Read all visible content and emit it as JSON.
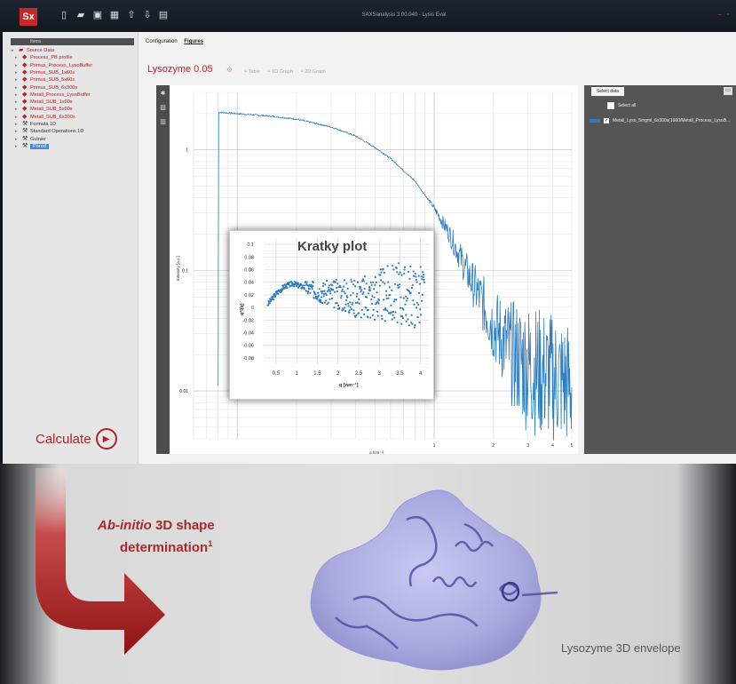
{
  "app": {
    "logo": "Sx",
    "title": "SAXSanalysis 3.00.040 - Lysis Eval",
    "toolbar_icons": [
      "new-file-icon",
      "open-folder-icon",
      "save-icon",
      "save-as-icon",
      "export-icon",
      "import-icon",
      "report-icon"
    ]
  },
  "tree": {
    "header": "Items",
    "items": [
      {
        "label": "Source Data",
        "color": "red",
        "icon": "folder-icon",
        "level": 0
      },
      {
        "label": "Process_PB profile",
        "color": "red",
        "icon": "data-icon",
        "level": 1
      },
      {
        "label": "Primus_Process_LysoBuffer",
        "color": "red",
        "icon": "data-icon",
        "level": 1
      },
      {
        "label": "Primus_SUB_1x60s",
        "color": "red",
        "icon": "data-icon",
        "level": 1
      },
      {
        "label": "Primus_SUB_5x60s",
        "color": "red",
        "icon": "data-icon",
        "level": 1
      },
      {
        "label": "Primus_SUB_6x300s",
        "color": "red",
        "icon": "data-icon",
        "level": 1
      },
      {
        "label": "Metall_Process_LysoBuffer",
        "color": "red",
        "icon": "data-icon",
        "level": 1
      },
      {
        "label": "Metall_SUB_1x60s",
        "color": "red",
        "icon": "data-icon",
        "level": 1
      },
      {
        "label": "Metall_SUB_5x60s",
        "color": "red",
        "icon": "data-icon",
        "level": 1
      },
      {
        "label": "Metall_SUB_6x300s",
        "color": "red",
        "icon": "data-icon",
        "level": 1
      },
      {
        "label": "Formula 1D",
        "color": "dark",
        "icon": "wrench-icon",
        "level": 1
      },
      {
        "label": "Standard Operations 1D",
        "color": "dark",
        "icon": "wrench-icon",
        "level": 1
      },
      {
        "label": "Guinier",
        "color": "dark",
        "icon": "wrench-icon",
        "level": 1
      },
      {
        "label": "Porod",
        "color": "dark",
        "icon": "wrench-icon",
        "level": 1,
        "selected": true
      }
    ]
  },
  "calculate_label": "Calculate",
  "tabs": {
    "configuration": "Configuration",
    "figures": "Figures"
  },
  "document_tab": "Lysozyme 0.05",
  "view_tabs": [
    "+ Table",
    "+ 1D Graph",
    "+ 2D Graph"
  ],
  "right_panel": {
    "select_data": "Select data",
    "select_all": "Select all",
    "series_label": "Metall_Lyso_5mgml_6x300s(1660/Metall_Process_LysoB..."
  },
  "colors": {
    "accent_red": "#b3212b",
    "series_blue": "#2f7fc0"
  },
  "chart_data": [
    {
      "type": "line",
      "scale": "log-log",
      "xlabel": "q [nm⁻¹]",
      "ylabel": "Intensity [a.u.]",
      "x_ticks": [
        "1",
        "2",
        "3",
        "4",
        "5"
      ],
      "y_ticks": [
        "1",
        "0.1",
        "0.01"
      ],
      "xlim": [
        0.06,
        5
      ],
      "ylim": [
        0.004,
        3
      ],
      "series": [
        {
          "color": "#2f7fc0",
          "x": [
            0.08,
            0.1,
            0.15,
            0.2,
            0.3,
            0.4,
            0.5,
            0.6,
            0.8,
            1.0,
            1.2,
            1.5,
            1.8,
            2.0,
            2.5,
            3.0,
            3.5,
            4.0,
            4.5,
            5.0
          ],
          "y": [
            2.05,
            2.0,
            1.9,
            1.8,
            1.55,
            1.3,
            1.05,
            0.85,
            0.55,
            0.33,
            0.2,
            0.09,
            0.05,
            0.035,
            0.02,
            0.016,
            0.014,
            0.013,
            0.012,
            0.011
          ]
        }
      ]
    },
    {
      "type": "scatter",
      "title": "Kratky plot",
      "xlabel": "q [nm⁻¹]",
      "ylabel": "q²I(q)",
      "x_ticks": [
        "0.5",
        "1",
        "1.5",
        "2",
        "2.5",
        "3",
        "3.5",
        "4"
      ],
      "y_ticks": [
        "0.1",
        "0.08",
        "0.06",
        "0.04",
        "0.02",
        "0",
        "-0.02",
        "-0.04",
        "-0.06",
        "-0.08"
      ],
      "xlim": [
        0.2,
        4.2
      ],
      "ylim": [
        -0.09,
        0.11
      ],
      "trend": {
        "x": [
          0.3,
          0.5,
          0.7,
          0.9,
          1.1,
          1.3,
          1.5,
          1.8,
          2.1,
          2.4,
          2.7,
          3.0,
          3.3,
          3.6,
          3.9,
          4.1
        ],
        "y": [
          0.005,
          0.022,
          0.033,
          0.038,
          0.034,
          0.03,
          0.026,
          0.022,
          0.02,
          0.017,
          0.016,
          0.02,
          0.022,
          0.02,
          0.018,
          0.02
        ]
      },
      "scatter_spread": 0.05
    }
  ],
  "lower": {
    "ab_initio_1": "Ab-initio",
    "ab_initio_2": " 3D shape",
    "ab_initio_3": "determination",
    "ab_initio_sup": "1",
    "envelope_caption": "Lysozyme 3D envelope"
  }
}
